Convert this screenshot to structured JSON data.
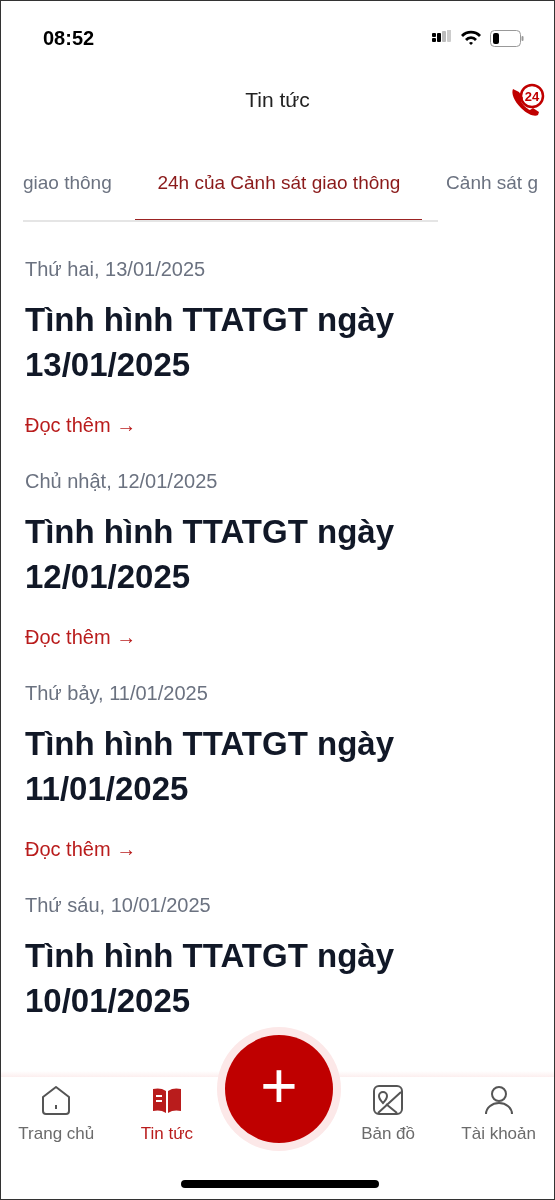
{
  "status_bar": {
    "time": "08:52"
  },
  "header": {
    "title": "Tin tức",
    "hotline_label": "24"
  },
  "tabs": [
    {
      "label": "giao thông",
      "selected": false
    },
    {
      "label": "24h của Cảnh sát giao thông",
      "selected": true
    },
    {
      "label": "Cảnh sát g",
      "selected": false
    }
  ],
  "articles": [
    {
      "date": "Thứ hai, 13/01/2025",
      "title": "Tình hình TTATGT ngày 13/01/2025",
      "link": "Đọc thêm →"
    },
    {
      "date": "Chủ nhật, 12/01/2025",
      "title": "Tình hình TTATGT ngày 12/01/2025",
      "link": "Đọc thêm →"
    },
    {
      "date": "Thứ bảy, 11/01/2025",
      "title": "Tình hình TTATGT ngày 11/01/2025",
      "link": "Đọc thêm →"
    },
    {
      "date": "Thứ sáu, 10/01/2025",
      "title": "Tình hình TTATGT ngày 10/01/2025"
    }
  ],
  "fab": {
    "label": "+"
  },
  "bottom_nav": [
    {
      "kind": "home",
      "label": "Trang chủ",
      "selected": false
    },
    {
      "kind": "news",
      "label": "Tin tức",
      "selected": true
    },
    {
      "kind": "gap"
    },
    {
      "kind": "map",
      "label": "Bản đồ",
      "selected": false
    },
    {
      "kind": "account",
      "label": "Tài khoản",
      "selected": false
    }
  ]
}
